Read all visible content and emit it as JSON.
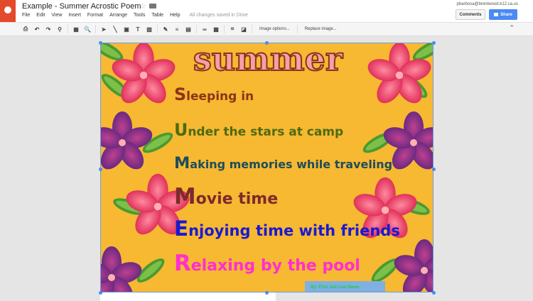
{
  "app": {
    "title": "Example - Summer Acrostic Poem",
    "status": "All changes saved in Drive",
    "account": "pbarbosa@brentwood.k12.ca.us",
    "menu": [
      "File",
      "Edit",
      "View",
      "Insert",
      "Format",
      "Arrange",
      "Tools",
      "Table",
      "Help"
    ],
    "comments_label": "Comments",
    "share_label": "Share"
  },
  "toolbar": {
    "icons": [
      "print-icon",
      "undo-icon",
      "redo-icon",
      "paint-format-icon",
      "fit-icon",
      "zoom-icon",
      "select-icon",
      "line-icon",
      "shape-icon",
      "textbox-icon",
      "image-icon",
      "pen-icon",
      "line-weight-icon",
      "line-dash-icon",
      "link-icon",
      "alt-text-icon",
      "crop-icon",
      "mask-icon"
    ],
    "glyphs": [
      "⎙",
      "↶",
      "↷",
      "⚲",
      "▦",
      "🔍",
      "➤",
      "╲",
      "▣",
      "T",
      "▨",
      "✎",
      "≡",
      "▤",
      "∞",
      "▩",
      "⌗",
      "◪"
    ],
    "image_options": "Image options...",
    "replace_image": "Replace image..."
  },
  "poem": {
    "title": "summer",
    "lines": [
      {
        "initial": "S",
        "rest": "leeping in",
        "color": "#8a3516"
      },
      {
        "initial": "U",
        "rest": "nder the stars at camp",
        "color": "#4d6b12"
      },
      {
        "initial": "M",
        "rest": "aking memories while traveling",
        "color": "#1d4d5a"
      },
      {
        "initial": "M",
        "rest": "ovie time",
        "color": "#7b2b2b"
      },
      {
        "initial": "E",
        "rest": "njoying time with friends",
        "color": "#1a1ad0"
      },
      {
        "initial": "R",
        "rest": "elaxing by the pool",
        "color": "#ff2fd0"
      }
    ],
    "byline": "By: First and Last Name"
  }
}
